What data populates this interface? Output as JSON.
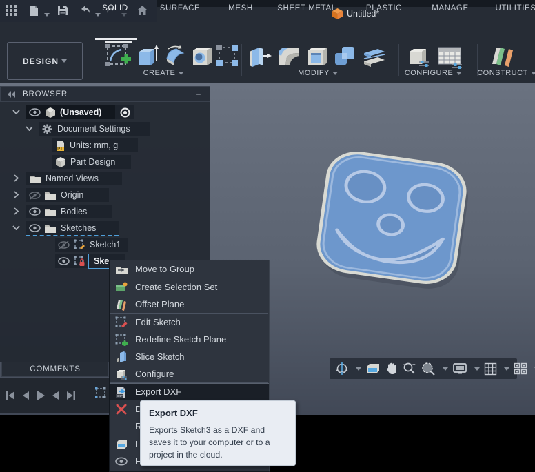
{
  "window": {
    "title": "Untitled*"
  },
  "tabs": [
    {
      "label": "SOLID"
    },
    {
      "label": "SURFACE"
    },
    {
      "label": "MESH"
    },
    {
      "label": "SHEET METAL"
    },
    {
      "label": "PLASTIC"
    },
    {
      "label": "MANAGE"
    },
    {
      "label": "UTILITIES"
    }
  ],
  "ribbon": {
    "design_label": "DESIGN",
    "create_label": "CREATE",
    "modify_label": "MODIFY",
    "configure_label": "CONFIGURE",
    "construct_label": "CONSTRUCT"
  },
  "browser": {
    "title": "BROWSER",
    "rows": {
      "unsaved": "(Unsaved)",
      "doc_settings": "Document Settings",
      "units": "Units: mm, g",
      "part_design": "Part Design",
      "named_views": "Named Views",
      "origin": "Origin",
      "bodies": "Bodies",
      "sketches": "Sketches",
      "sketch1": "Sketch1",
      "sketch3": "Ske"
    }
  },
  "comments": {
    "title": "COMMENTS"
  },
  "menu": {
    "items": [
      {
        "label": "Move to Group"
      },
      {
        "label": "Create Selection Set"
      },
      {
        "label": "Offset Plane"
      },
      {
        "label": "Edit Sketch"
      },
      {
        "label": "Redefine Sketch Plane"
      },
      {
        "label": "Slice Sketch"
      },
      {
        "label": "Configure"
      },
      {
        "label": "Export DXF"
      },
      {
        "label": "De"
      },
      {
        "label": "Re"
      },
      {
        "label": "Lo"
      },
      {
        "label": "Hi"
      }
    ]
  },
  "tooltip": {
    "title": "Export DXF",
    "body": "Exports Sketch3 as a DXF and saves it to your computer or to a project in the cloud."
  },
  "colors": {
    "accent_blue": "#57a8e0",
    "brand_orange": "#e8833a",
    "model_blue": "#6d97cc",
    "tooltip_bg": "#e9edf3"
  }
}
